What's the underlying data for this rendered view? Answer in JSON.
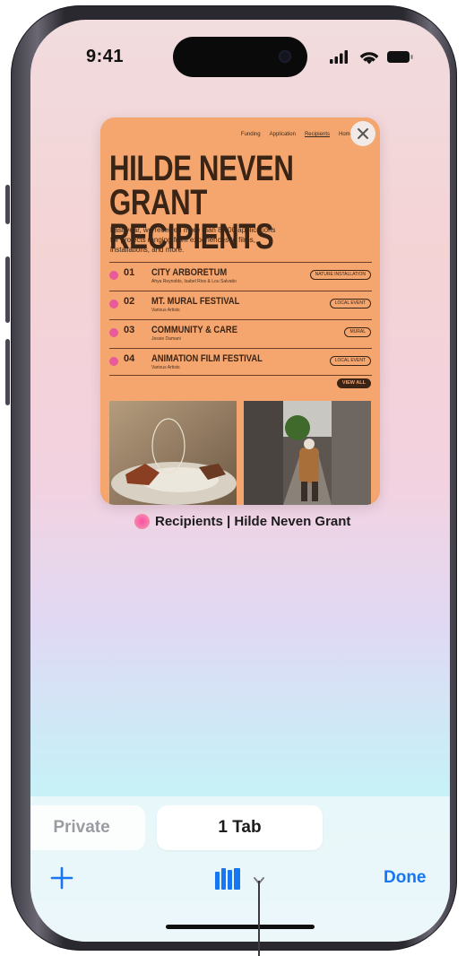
{
  "status_bar": {
    "time": "9:41"
  },
  "tab": {
    "page_title": "Recipients | Hilde Neven Grant",
    "site": {
      "nav": [
        "Funding",
        "Application",
        "Recipients",
        "Home"
      ],
      "title": "HILDE NEVEN\nGRANT RECIPIENTS",
      "intro": "Last year, we received more than 8,000 applications for projects ranging from experiences to films, installations, and more.",
      "recipients": [
        {
          "num": "01",
          "name": "CITY ARBORETUM",
          "sub": "Ahya Reynolds, Isabel Rios & Lou Salvatio",
          "tag": "NATURE INSTALLATION"
        },
        {
          "num": "02",
          "name": "MT. MURAL FESTIVAL",
          "sub": "Various Artists",
          "tag": "LOCAL EVENT"
        },
        {
          "num": "03",
          "name": "COMMUNITY & CARE",
          "sub": "Jessie Damani",
          "tag": "MURAL"
        },
        {
          "num": "04",
          "name": "ANIMATION FILM FESTIVAL",
          "sub": "Various Artists",
          "tag": "LOCAL EVENT"
        }
      ],
      "view_all": "VIEW ALL"
    }
  },
  "segmented": {
    "private": "Private",
    "tabs": "1 Tab"
  },
  "toolbar": {
    "done": "Done"
  },
  "colors": {
    "accent": "#1776f2",
    "card": "#f4a66e",
    "ink": "#3a2416",
    "bullet": "#e85a9a"
  }
}
